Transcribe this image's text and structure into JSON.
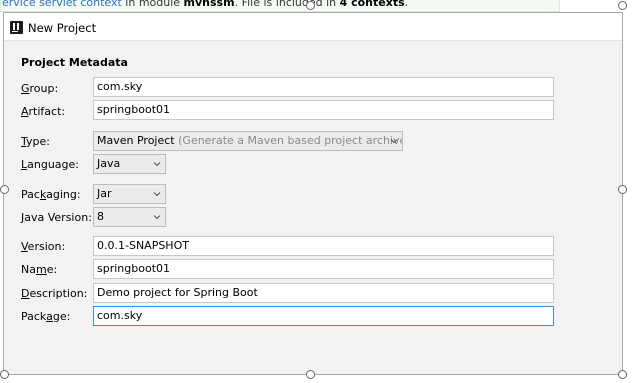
{
  "background": {
    "text_prefix": "ervice servlet context",
    "text_mid": " in module ",
    "text_module": "mvnssm",
    "text_mid2": ". File is included in ",
    "text_count": "4 contexts",
    "text_end": "."
  },
  "dialog": {
    "title": "New Project",
    "section_title": "Project Metadata"
  },
  "form": {
    "group": {
      "label_mnemonic": "G",
      "label_rest": "roup:",
      "value": "com.sky"
    },
    "artifact": {
      "label_mnemonic": "A",
      "label_rest": "rtifact:",
      "value": "springboot01"
    },
    "type": {
      "label_mnemonic": "T",
      "label_rest": "ype:",
      "value": "Maven Project",
      "description": "(Generate a Maven based project archive.)"
    },
    "language": {
      "label_mnemonic": "L",
      "label_rest": "anguage:",
      "value": "Java"
    },
    "packaging": {
      "label_prefix": "Pac",
      "label_mnemonic": "k",
      "label_rest": "aging:",
      "value": "Jar"
    },
    "java_version": {
      "label_mnemonic": "J",
      "label_rest": "ava Version:",
      "value": "8"
    },
    "version": {
      "label_mnemonic": "V",
      "label_rest": "ersion:",
      "value": "0.0.1-SNAPSHOT"
    },
    "name": {
      "label_prefix": "Na",
      "label_mnemonic": "m",
      "label_rest": "e:",
      "value": "springboot01"
    },
    "description": {
      "label_mnemonic": "D",
      "label_rest": "escription:",
      "value": "Demo project for Spring Boot"
    },
    "package": {
      "label_prefix": "Pack",
      "label_mnemonic": "a",
      "label_rest": "ge:",
      "value": "com.sky"
    }
  },
  "icons": {
    "app": "intellij-app-icon",
    "dropdown": "chevron-down-icon",
    "resize": "resize-handle-icon"
  },
  "colors": {
    "dialog_bg": "#f2f2f2",
    "field_border": "#c7c7c7",
    "focus_border": "#3d8ee0",
    "link": "#2e6fbe"
  }
}
